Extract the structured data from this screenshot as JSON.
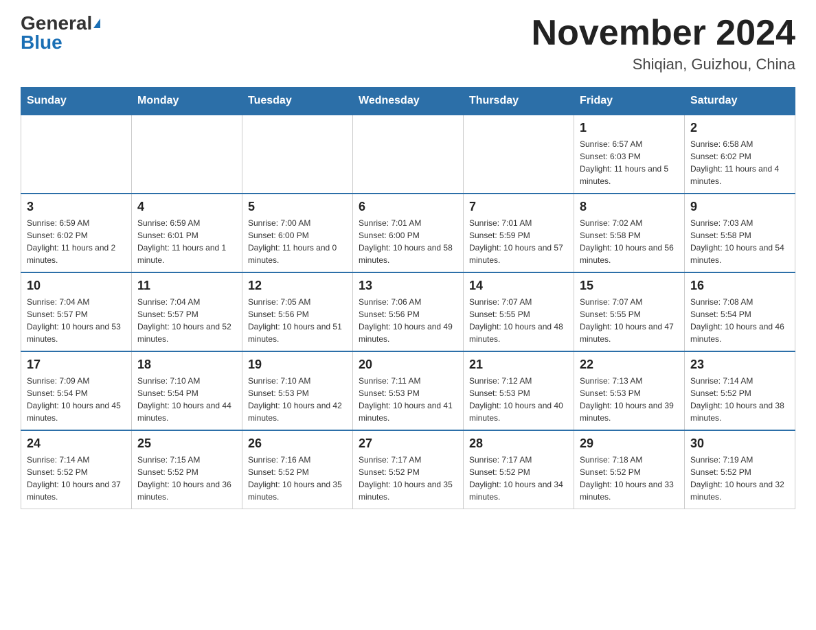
{
  "header": {
    "logo_general": "General",
    "logo_blue": "Blue",
    "month_title": "November 2024",
    "location": "Shiqian, Guizhou, China"
  },
  "weekdays": [
    "Sunday",
    "Monday",
    "Tuesday",
    "Wednesday",
    "Thursday",
    "Friday",
    "Saturday"
  ],
  "weeks": [
    [
      {
        "day": "",
        "sunrise": "",
        "sunset": "",
        "daylight": ""
      },
      {
        "day": "",
        "sunrise": "",
        "sunset": "",
        "daylight": ""
      },
      {
        "day": "",
        "sunrise": "",
        "sunset": "",
        "daylight": ""
      },
      {
        "day": "",
        "sunrise": "",
        "sunset": "",
        "daylight": ""
      },
      {
        "day": "",
        "sunrise": "",
        "sunset": "",
        "daylight": ""
      },
      {
        "day": "1",
        "sunrise": "Sunrise: 6:57 AM",
        "sunset": "Sunset: 6:03 PM",
        "daylight": "Daylight: 11 hours and 5 minutes."
      },
      {
        "day": "2",
        "sunrise": "Sunrise: 6:58 AM",
        "sunset": "Sunset: 6:02 PM",
        "daylight": "Daylight: 11 hours and 4 minutes."
      }
    ],
    [
      {
        "day": "3",
        "sunrise": "Sunrise: 6:59 AM",
        "sunset": "Sunset: 6:02 PM",
        "daylight": "Daylight: 11 hours and 2 minutes."
      },
      {
        "day": "4",
        "sunrise": "Sunrise: 6:59 AM",
        "sunset": "Sunset: 6:01 PM",
        "daylight": "Daylight: 11 hours and 1 minute."
      },
      {
        "day": "5",
        "sunrise": "Sunrise: 7:00 AM",
        "sunset": "Sunset: 6:00 PM",
        "daylight": "Daylight: 11 hours and 0 minutes."
      },
      {
        "day": "6",
        "sunrise": "Sunrise: 7:01 AM",
        "sunset": "Sunset: 6:00 PM",
        "daylight": "Daylight: 10 hours and 58 minutes."
      },
      {
        "day": "7",
        "sunrise": "Sunrise: 7:01 AM",
        "sunset": "Sunset: 5:59 PM",
        "daylight": "Daylight: 10 hours and 57 minutes."
      },
      {
        "day": "8",
        "sunrise": "Sunrise: 7:02 AM",
        "sunset": "Sunset: 5:58 PM",
        "daylight": "Daylight: 10 hours and 56 minutes."
      },
      {
        "day": "9",
        "sunrise": "Sunrise: 7:03 AM",
        "sunset": "Sunset: 5:58 PM",
        "daylight": "Daylight: 10 hours and 54 minutes."
      }
    ],
    [
      {
        "day": "10",
        "sunrise": "Sunrise: 7:04 AM",
        "sunset": "Sunset: 5:57 PM",
        "daylight": "Daylight: 10 hours and 53 minutes."
      },
      {
        "day": "11",
        "sunrise": "Sunrise: 7:04 AM",
        "sunset": "Sunset: 5:57 PM",
        "daylight": "Daylight: 10 hours and 52 minutes."
      },
      {
        "day": "12",
        "sunrise": "Sunrise: 7:05 AM",
        "sunset": "Sunset: 5:56 PM",
        "daylight": "Daylight: 10 hours and 51 minutes."
      },
      {
        "day": "13",
        "sunrise": "Sunrise: 7:06 AM",
        "sunset": "Sunset: 5:56 PM",
        "daylight": "Daylight: 10 hours and 49 minutes."
      },
      {
        "day": "14",
        "sunrise": "Sunrise: 7:07 AM",
        "sunset": "Sunset: 5:55 PM",
        "daylight": "Daylight: 10 hours and 48 minutes."
      },
      {
        "day": "15",
        "sunrise": "Sunrise: 7:07 AM",
        "sunset": "Sunset: 5:55 PM",
        "daylight": "Daylight: 10 hours and 47 minutes."
      },
      {
        "day": "16",
        "sunrise": "Sunrise: 7:08 AM",
        "sunset": "Sunset: 5:54 PM",
        "daylight": "Daylight: 10 hours and 46 minutes."
      }
    ],
    [
      {
        "day": "17",
        "sunrise": "Sunrise: 7:09 AM",
        "sunset": "Sunset: 5:54 PM",
        "daylight": "Daylight: 10 hours and 45 minutes."
      },
      {
        "day": "18",
        "sunrise": "Sunrise: 7:10 AM",
        "sunset": "Sunset: 5:54 PM",
        "daylight": "Daylight: 10 hours and 44 minutes."
      },
      {
        "day": "19",
        "sunrise": "Sunrise: 7:10 AM",
        "sunset": "Sunset: 5:53 PM",
        "daylight": "Daylight: 10 hours and 42 minutes."
      },
      {
        "day": "20",
        "sunrise": "Sunrise: 7:11 AM",
        "sunset": "Sunset: 5:53 PM",
        "daylight": "Daylight: 10 hours and 41 minutes."
      },
      {
        "day": "21",
        "sunrise": "Sunrise: 7:12 AM",
        "sunset": "Sunset: 5:53 PM",
        "daylight": "Daylight: 10 hours and 40 minutes."
      },
      {
        "day": "22",
        "sunrise": "Sunrise: 7:13 AM",
        "sunset": "Sunset: 5:53 PM",
        "daylight": "Daylight: 10 hours and 39 minutes."
      },
      {
        "day": "23",
        "sunrise": "Sunrise: 7:14 AM",
        "sunset": "Sunset: 5:52 PM",
        "daylight": "Daylight: 10 hours and 38 minutes."
      }
    ],
    [
      {
        "day": "24",
        "sunrise": "Sunrise: 7:14 AM",
        "sunset": "Sunset: 5:52 PM",
        "daylight": "Daylight: 10 hours and 37 minutes."
      },
      {
        "day": "25",
        "sunrise": "Sunrise: 7:15 AM",
        "sunset": "Sunset: 5:52 PM",
        "daylight": "Daylight: 10 hours and 36 minutes."
      },
      {
        "day": "26",
        "sunrise": "Sunrise: 7:16 AM",
        "sunset": "Sunset: 5:52 PM",
        "daylight": "Daylight: 10 hours and 35 minutes."
      },
      {
        "day": "27",
        "sunrise": "Sunrise: 7:17 AM",
        "sunset": "Sunset: 5:52 PM",
        "daylight": "Daylight: 10 hours and 35 minutes."
      },
      {
        "day": "28",
        "sunrise": "Sunrise: 7:17 AM",
        "sunset": "Sunset: 5:52 PM",
        "daylight": "Daylight: 10 hours and 34 minutes."
      },
      {
        "day": "29",
        "sunrise": "Sunrise: 7:18 AM",
        "sunset": "Sunset: 5:52 PM",
        "daylight": "Daylight: 10 hours and 33 minutes."
      },
      {
        "day": "30",
        "sunrise": "Sunrise: 7:19 AM",
        "sunset": "Sunset: 5:52 PM",
        "daylight": "Daylight: 10 hours and 32 minutes."
      }
    ]
  ]
}
